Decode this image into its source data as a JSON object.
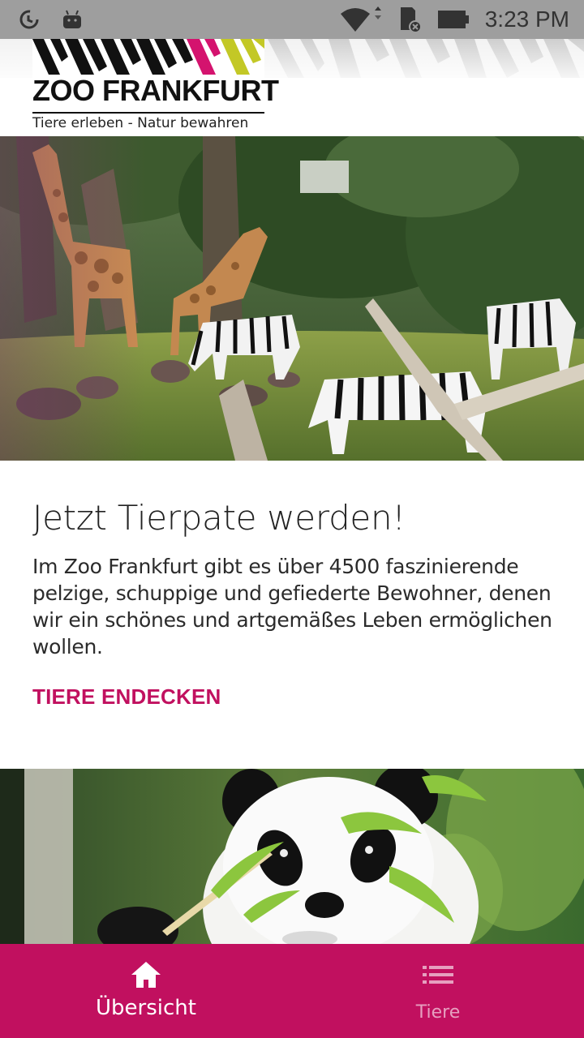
{
  "status_bar": {
    "time": "3:23 PM",
    "left_icons": [
      "data-saver-icon",
      "android-icon"
    ],
    "right_icons": [
      "wifi-icon",
      "sd-card-icon",
      "battery-icon"
    ],
    "background": "#9e9e9e"
  },
  "header": {
    "logo_title": "ZOO FRANKFURT",
    "logo_tagline": "Tiere erleben - Natur bewahren"
  },
  "hero_image": {
    "subject": "giraffes and zebras in savanna enclosure"
  },
  "card": {
    "title": "Jetzt Tierpate werden!",
    "body": "Im Zoo Frankfurt gibt es über 4500 faszinierende pelzige, schuppige und gefiederte Bewohner, denen wir ein schönes und artgemäßes Leben ermöglichen wollen.",
    "action_label": "TIERE ENDECKEN"
  },
  "second_image": {
    "subject": "giant panda eating bamboo"
  },
  "bottom_nav": {
    "items": [
      {
        "label": "Übersicht",
        "icon": "home-icon",
        "active": true
      },
      {
        "label": "Tiere",
        "icon": "list-icon",
        "active": false
      }
    ],
    "background": "#c1105f"
  },
  "colors": {
    "accent": "#c1105f",
    "logo_magenta": "#d4136e",
    "logo_yellow": "#c3c826"
  }
}
